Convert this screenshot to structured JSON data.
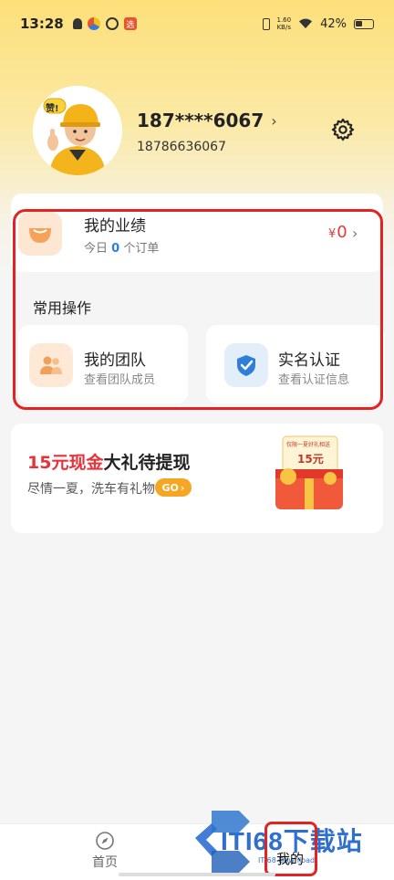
{
  "status_bar": {
    "time": "13:28",
    "net_speed_value": "1.60",
    "net_speed_unit": "KB/s",
    "battery": "42%"
  },
  "profile": {
    "badge": "赞!",
    "masked_phone": "187****6067",
    "full_phone": "18786636067"
  },
  "performance": {
    "title": "我的业绩",
    "today_prefix": "今日",
    "today_count": "0",
    "today_suffix": "个订单",
    "currency": "¥",
    "amount": "0"
  },
  "common_ops": {
    "title": "常用操作",
    "items": [
      {
        "title": "我的团队",
        "subtitle": "查看团队成员",
        "icon": "team-icon"
      },
      {
        "title": "实名认证",
        "subtitle": "查看认证信息",
        "icon": "shield-check-icon"
      }
    ]
  },
  "promo": {
    "highlight": "15元现金",
    "title_rest": "大礼待提现",
    "subtitle": "尽情一夏，洗车有礼物",
    "go_label": "GO",
    "gift_banner": "仅限一夏好礼相送",
    "gift_value": "15元"
  },
  "bottom_nav": {
    "items": [
      {
        "label": "首页",
        "icon": "home-compass-icon"
      },
      {
        "label": "我的",
        "icon": "profile-icon"
      }
    ]
  },
  "watermark": {
    "text": "ITI68下载站",
    "sub": "ITI68 Download"
  },
  "colors": {
    "accent_blue": "#2f7fd8",
    "price_red": "#e53a3a",
    "promo_red": "#e8323a",
    "go_orange": "#f5a623",
    "annotation_red": "#e32222"
  }
}
